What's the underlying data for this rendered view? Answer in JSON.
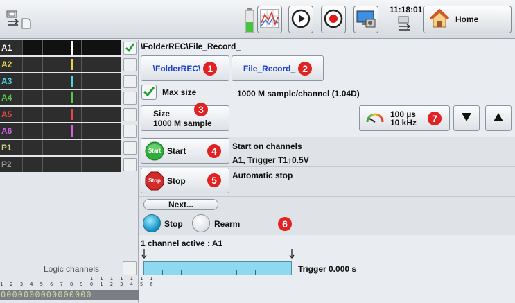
{
  "topbar": {
    "time": "11:18:01",
    "home_label": "Home",
    "icons": [
      "usb-icon",
      "sd-card-icon",
      "battery-icon",
      "chart-icon",
      "play-icon",
      "record-icon",
      "monitor-icon",
      "usb-icon",
      "home-icon"
    ]
  },
  "channels": [
    {
      "label": "A1",
      "color": "#ffffff",
      "checked": true
    },
    {
      "label": "A2",
      "color": "#e8d44a",
      "checked": false
    },
    {
      "label": "A3",
      "color": "#4fd3e0",
      "checked": false
    },
    {
      "label": "A4",
      "color": "#58c84a",
      "checked": false
    },
    {
      "label": "A5",
      "color": "#e34848",
      "checked": false
    },
    {
      "label": "A6",
      "color": "#d25ee0",
      "checked": false
    },
    {
      "label": "P1",
      "color": "#cfcf8a",
      "checked": false
    },
    {
      "label": "P2",
      "color": "#9a9a9a",
      "checked": false
    }
  ],
  "logic": {
    "title": "Logic channels",
    "numbers_row1": "                  1 1 1 1 1 1 1",
    "numbers_row2": "1 2 3 4 5 6 7 8 9 0 1 2 3 4 5 6",
    "bits": "0000000000000000"
  },
  "main": {
    "path": "\\FolderREC\\File_Record_",
    "folder_button": "\\FolderREC\\",
    "file_button": "File_Record_",
    "max_size_label": "Max size",
    "max_size_value": "1000 M sample/channel (1.04D)",
    "size_label": "Size",
    "size_value": "1000  M sample",
    "period_value": "100 µs",
    "freq_value": "10 kHz",
    "start_button": "Start",
    "start_icon_text": "Start",
    "start_info1": "Start on channels",
    "start_info2": "A1, Trigger T1↑0.5V",
    "stop_button": "Stop",
    "stop_icon_text": "Stop",
    "stop_info": "Automatic stop",
    "next_button": "Next...",
    "radio_stop": "Stop",
    "radio_rearm": "Rearm",
    "channel_active": "1 channel active : A1",
    "trigger_label": "Trigger 0.000 s",
    "badges": [
      "1",
      "2",
      "3",
      "4",
      "5",
      "6",
      "7"
    ]
  },
  "colors": {
    "badge": "#e02222",
    "link_blue": "#1a3fd0",
    "timeline": "#8fd9f0"
  }
}
